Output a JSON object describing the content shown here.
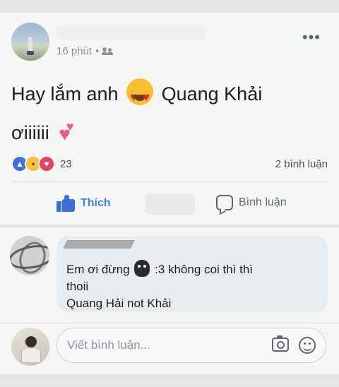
{
  "post": {
    "time": "16 phút",
    "separator": "•",
    "audience_icon": "friends-icon",
    "more_icon": "more-horizontal-icon",
    "more_glyph": "•••",
    "text_part1": "Hay lắm anh",
    "text_part2": "Quang Khải",
    "text_part3": "ơiiiiii",
    "emoji1": "heart-eyes-emoji",
    "emoji2": "two-hearts-emoji",
    "reaction_count": "23",
    "reaction_icons": [
      "like-reaction-icon",
      "haha-reaction-icon",
      "love-reaction-icon"
    ],
    "comment_count": "2 bình luận"
  },
  "actions": {
    "like_label": "Thích",
    "comment_label": "Bình luận"
  },
  "comment": {
    "line1_before": "Em ơi đừng",
    "line1_after": ":3 không coi thì thì",
    "line2": "thoii",
    "line3": "Quang Hải not Khải"
  },
  "composer": {
    "placeholder": "Viết bình luận...",
    "camera_icon": "camera-icon",
    "emoji_icon": "smile-icon"
  },
  "colors": {
    "accent": "#4080e8",
    "background": "#f4f6f4",
    "muted_text": "#8d949e"
  }
}
